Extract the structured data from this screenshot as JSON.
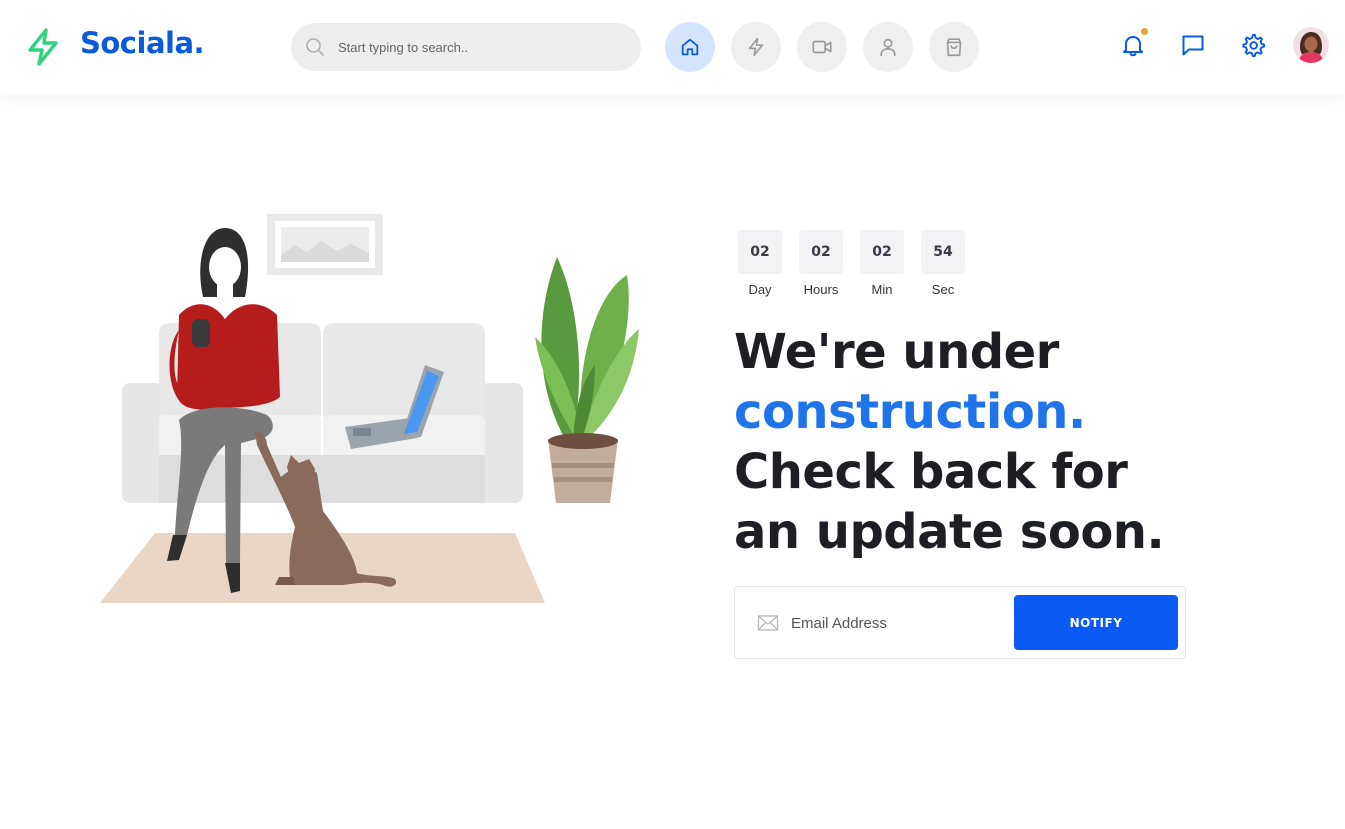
{
  "brand": {
    "name": "Sociala.",
    "logo_icon": "lightning-icon",
    "color": "#0a5bdb",
    "logo_color": "#2fd57a"
  },
  "search": {
    "placeholder": "Start typing to search..",
    "value": ""
  },
  "nav": [
    {
      "name": "home",
      "icon": "home-icon",
      "active": true
    },
    {
      "name": "feed",
      "icon": "lightning-icon",
      "active": false
    },
    {
      "name": "videos",
      "icon": "video-icon",
      "active": false
    },
    {
      "name": "profile",
      "icon": "user-icon",
      "active": false
    },
    {
      "name": "shop",
      "icon": "shopping-bag-icon",
      "active": false
    }
  ],
  "header_actions": [
    {
      "name": "notifications",
      "icon": "bell-icon",
      "has_dot": true
    },
    {
      "name": "messages",
      "icon": "chat-icon"
    },
    {
      "name": "settings",
      "icon": "gear-icon"
    },
    {
      "name": "account",
      "icon": "avatar"
    }
  ],
  "countdown": [
    {
      "value": "02",
      "label": "Day"
    },
    {
      "value": "02",
      "label": "Hours"
    },
    {
      "value": "02",
      "label": "Min"
    },
    {
      "value": "54",
      "label": "Sec"
    }
  ],
  "headline": {
    "line1": "We're under",
    "highlight": "construction.",
    "line3": "Check back for",
    "line4": "an update soon."
  },
  "subscribe": {
    "placeholder": "Email Address",
    "value": "",
    "button_label": "NOTIFY"
  },
  "colors": {
    "accent": "#0a5af5",
    "highlight": "#1e74e8",
    "text": "#1e1f24"
  }
}
